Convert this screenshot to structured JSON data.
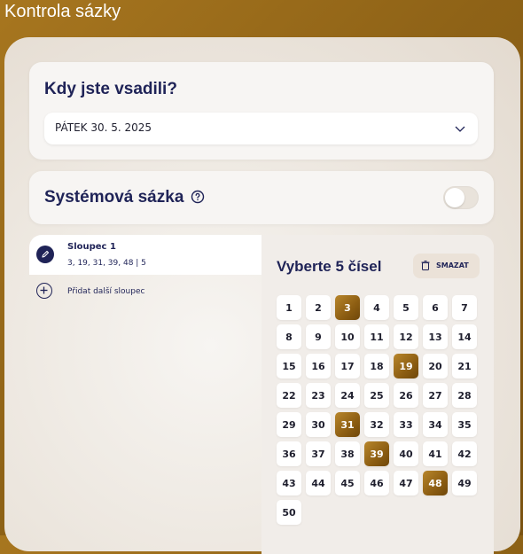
{
  "page": {
    "title": "Kontrola sázky"
  },
  "date_card": {
    "heading": "Kdy jste vsadili?",
    "selected": "PÁTEK 30. 5. 2025"
  },
  "system_card": {
    "heading": "Systémová sázka",
    "toggle_on": false
  },
  "columns": {
    "items": [
      {
        "title": "Sloupec 1",
        "summary": "3, 19, 31, 39, 48 | 5"
      }
    ],
    "add_label": "Přidat další sloupec"
  },
  "picker": {
    "heading": "Vyberte 5 čísel",
    "clear_label": "SMAZAT",
    "numbers": [
      1,
      2,
      3,
      4,
      5,
      6,
      7,
      8,
      9,
      10,
      11,
      12,
      13,
      14,
      15,
      16,
      17,
      18,
      19,
      20,
      21,
      22,
      23,
      24,
      25,
      26,
      27,
      28,
      29,
      30,
      31,
      32,
      33,
      34,
      35,
      36,
      37,
      38,
      39,
      40,
      41,
      42,
      43,
      44,
      45,
      46,
      47,
      48,
      49,
      50
    ],
    "selected": [
      3,
      19,
      31,
      39,
      48
    ]
  },
  "colors": {
    "brand_gold": "#8f6317",
    "navy": "#1f2357"
  }
}
